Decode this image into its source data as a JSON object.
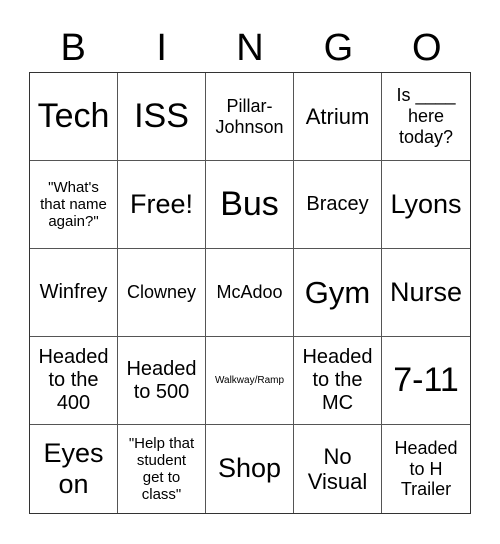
{
  "header": {
    "letters": [
      "B",
      "I",
      "N",
      "G",
      "O"
    ]
  },
  "board": {
    "rows": [
      [
        "Tech",
        "ISS",
        "Pillar-\nJohnson",
        "Atrium",
        "Is ____\nhere\ntoday?"
      ],
      [
        "\"What's\nthat name\nagain?\"",
        "Free!",
        "Bus",
        "Bracey",
        "Lyons"
      ],
      [
        "Winfrey",
        "Clowney",
        "McAdoo",
        "Gym",
        "Nurse"
      ],
      [
        "Headed\nto the\n400",
        "Headed\nto 500",
        "Walkway/Ramp",
        "Headed\nto the\nMC",
        "7-11"
      ],
      [
        "Eyes\non",
        "\"Help that\nstudent\nget to\nclass\"",
        "Shop",
        "No\nVisual",
        "Headed\nto H\nTrailer"
      ]
    ],
    "free_space": "Free!"
  }
}
